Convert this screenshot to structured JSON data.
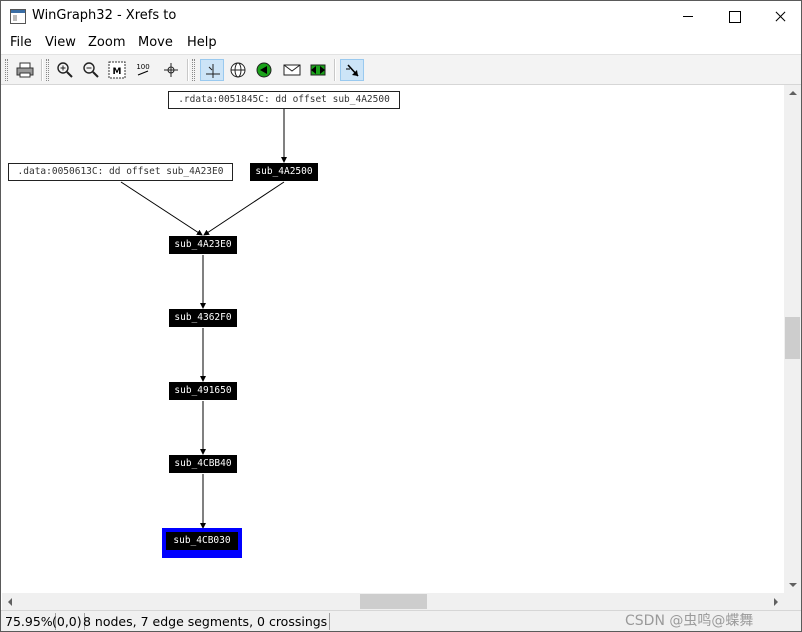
{
  "window": {
    "title": "WinGraph32 - Xrefs to"
  },
  "menu": {
    "items": [
      "File",
      "View",
      "Zoom",
      "Move",
      "Help"
    ]
  },
  "toolbar": {
    "buttons": [
      "printer-icon",
      "zoom-in-icon",
      "zoom-out-icon",
      "fit-window-icon",
      "zoom-100-icon",
      "center-icon",
      "layout-icon",
      "globe-icon",
      "green-node-icon",
      "envelope-icon",
      "green-arrows-icon",
      "select-arrow-icon"
    ],
    "zoom_100_label": "100",
    "fit_label": "M"
  },
  "graph": {
    "nodes": [
      {
        "id": "n1",
        "label": ".rdata:0051845C: dd offset sub_4A2500",
        "kind": "data"
      },
      {
        "id": "n2",
        "label": ".data:0050613C: dd offset sub_4A23E0",
        "kind": "data"
      },
      {
        "id": "n3",
        "label": "sub_4A2500",
        "kind": "function"
      },
      {
        "id": "n4",
        "label": "sub_4A23E0",
        "kind": "function"
      },
      {
        "id": "n5",
        "label": "sub_4362F0",
        "kind": "function"
      },
      {
        "id": "n6",
        "label": "sub_491650",
        "kind": "function"
      },
      {
        "id": "n7",
        "label": "sub_4CBB40",
        "kind": "function"
      },
      {
        "id": "n8",
        "label": "sub_4CB030",
        "kind": "function",
        "selected": true
      }
    ],
    "edges": [
      [
        "n1",
        "n3"
      ],
      [
        "n2",
        "n4"
      ],
      [
        "n3",
        "n4"
      ],
      [
        "n4",
        "n5"
      ],
      [
        "n5",
        "n6"
      ],
      [
        "n6",
        "n7"
      ],
      [
        "n7",
        "n8"
      ]
    ],
    "selection_color": "#0000ff"
  },
  "status": {
    "zoom": "75.95%",
    "coords": "(0,0)",
    "summary": "8 nodes, 7 edge segments, 0 crossings",
    "watermark": "CSDN @虫鸣@蝶舞"
  }
}
